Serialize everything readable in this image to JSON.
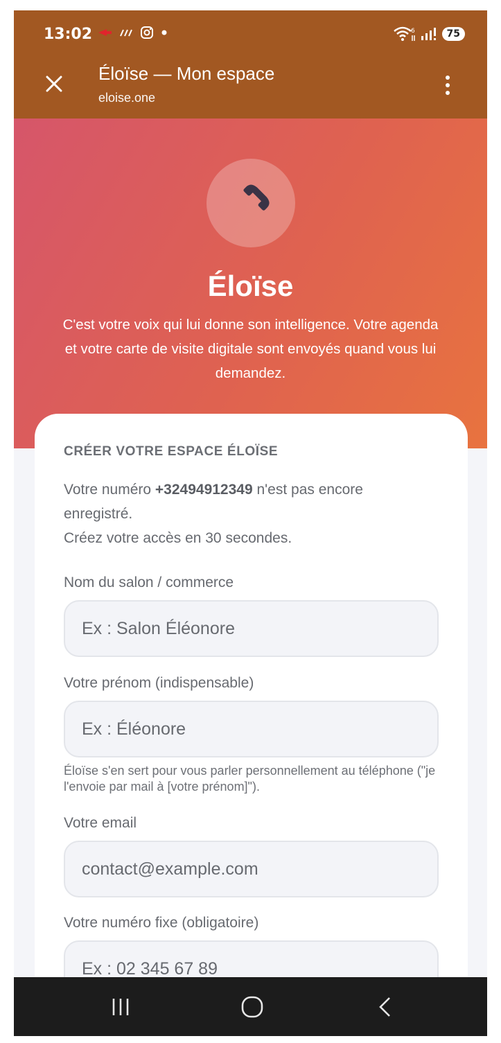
{
  "status_bar": {
    "time": "13:02",
    "battery": "75"
  },
  "app_bar": {
    "title": "Éloïse — Mon espace",
    "url": "eloise.one"
  },
  "hero": {
    "icon": "phone-icon",
    "title": "Éloïse",
    "subtitle": "C'est votre voix qui lui donne son intelligence. Votre agenda et votre carte de visite digitale sont envoyés quand vous lui demandez."
  },
  "form": {
    "heading": "CRÉER VOTRE ESPACE ÉLOÏSE",
    "intro_prefix": "Votre numéro ",
    "phone_number": "+32494912349",
    "intro_suffix": " n'est pas encore enregistré.",
    "intro_line2": "Créez votre accès en 30 secondes.",
    "fields": [
      {
        "label": "Nom du salon / commerce",
        "placeholder": "Ex : Salon Éléonore",
        "value": ""
      },
      {
        "label": "Votre prénom (indispensable)",
        "placeholder": "Ex : Éléonore",
        "value": "",
        "hint": "Éloïse s'en sert pour vous parler personnellement au téléphone (\"je l'envoie par mail à [votre prénom]\")."
      },
      {
        "label": "Votre email",
        "placeholder": "contact@example.com",
        "value": ""
      },
      {
        "label": "Votre numéro fixe (obligatoire)",
        "placeholder": "Ex : 02 345 67 89",
        "value": ""
      }
    ]
  },
  "colors": {
    "app_bar": "#a25822",
    "hero_gradient_start": "#d6566a",
    "hero_gradient_end": "#e8733f",
    "phone_icon": "#3a3346",
    "nav_bar": "#1c1c1c"
  }
}
